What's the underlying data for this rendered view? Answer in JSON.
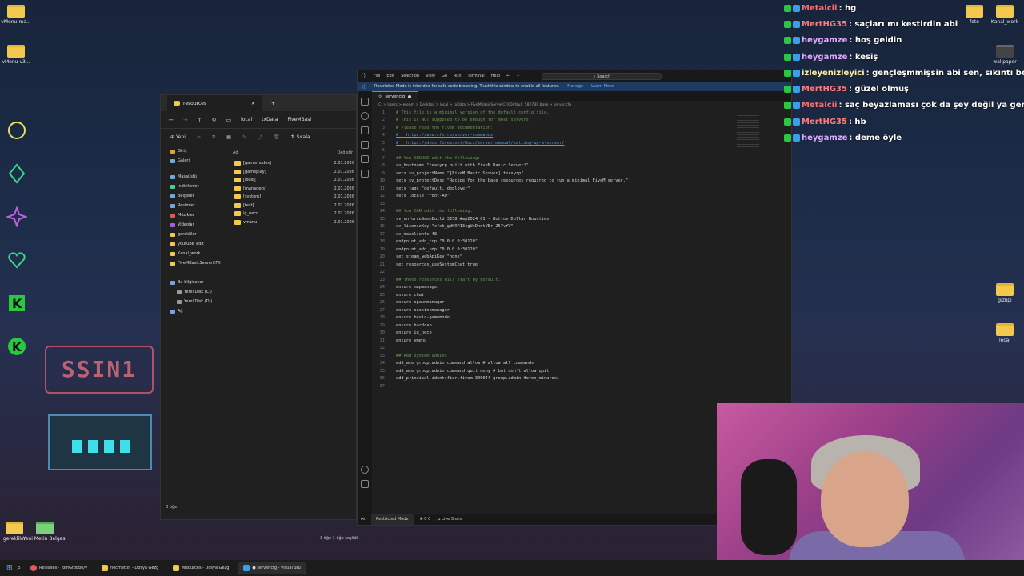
{
  "desktop": {
    "icons_left": [
      {
        "label": "vMenu-ma..."
      },
      {
        "label": "vMenu-v3..."
      }
    ],
    "icons_bottom": [
      {
        "label": "gerekliler"
      },
      {
        "label": "Yeni Metin Belgesi"
      }
    ],
    "icons_right": [
      {
        "label": "foto"
      },
      {
        "label": "Kanal_work"
      },
      {
        "label": "wallpaper"
      },
      {
        "label": "gizlipi"
      },
      {
        "label": "local"
      }
    ],
    "sign_text": "SSIN1"
  },
  "explorer": {
    "tab_title": "resources",
    "breadcrumbs": [
      "local",
      "txData",
      "FiveMBasi"
    ],
    "toolbar": {
      "new_label": "Yeni",
      "sort_label": "Sırala"
    },
    "sidebar": [
      "Giriş",
      "Galeri",
      "Masaüstü",
      "İndirilenler",
      "Belgeler",
      "Resimler",
      "Müzikler",
      "Videolar",
      "gerekliler",
      "youtube_edit",
      "Kanal_work",
      "FiveMBasicServerCFX",
      "Bu bilgisayar",
      "Yerel Disk (C:)",
      "Yerel Disk (D:)",
      "Ağ"
    ],
    "columns": {
      "name": "Ad",
      "date": "Değiştir"
    },
    "rows": [
      {
        "name": "[gamemodes]",
        "date": "2.01.2026"
      },
      {
        "name": "[gameplay]",
        "date": "2.01.2026"
      },
      {
        "name": "[local]",
        "date": "2.01.2026"
      },
      {
        "name": "[managers]",
        "date": "2.01.2026"
      },
      {
        "name": "[system]",
        "date": "2.01.2026"
      },
      {
        "name": "[test]",
        "date": "2.01.2026"
      },
      {
        "name": "ig_neco",
        "date": "2.01.2026"
      },
      {
        "name": "vmenu",
        "date": "2.01.2026"
      }
    ],
    "status": "8 öğe",
    "status2": "3 öğe   1 öğe seçildi"
  },
  "vscode": {
    "menu": [
      "File",
      "Edit",
      "Selection",
      "View",
      "Go",
      "Run",
      "Terminal",
      "Help"
    ],
    "search_placeholder": "Search",
    "banner": {
      "text": "Restricted Mode is intended for safe code browsing. Trust this window to enable all features.",
      "manage": "Manage",
      "learn": "Learn More"
    },
    "tab": "server.cfg",
    "breadcrumb": "C: > Users > erenm > Desktop > local > txData > FiveMBasicServerCFXDefault_5827B0.base > server.cfg",
    "status": {
      "restricted": "Restricted Mode",
      "problems": "0  0",
      "live_share": "Live Share"
    },
    "lines": [
      {
        "n": "1",
        "t": "# This file is a minimal version of the default config file.",
        "c": "cmt"
      },
      {
        "n": "2",
        "t": "# This is NOT supposed to be enough for most servers.",
        "c": "cmt"
      },
      {
        "n": "3",
        "t": "# Please read the fivem documentation:",
        "c": "cmt"
      },
      {
        "n": "4",
        "t": "#   https://aka.cfx.re/server-commands",
        "c": "link"
      },
      {
        "n": "5",
        "t": "#   https://docs.fivem.net/docs/server-manual/setting-up-a-server/",
        "c": "link"
      },
      {
        "n": "6",
        "t": "",
        "c": "kw"
      },
      {
        "n": "7",
        "t": "## You SHOULD edit the following:",
        "c": "cmt"
      },
      {
        "n": "8",
        "t": "sv_hostname \"teasyrp built with FiveM Basic Server!\"",
        "c": "mix"
      },
      {
        "n": "9",
        "t": "sets sv_projectName \"[FiveM Basic Server] teasyrp\"",
        "c": "mix"
      },
      {
        "n": "10",
        "t": "sets sv_projectDesc \"Recipe for the base resources required to run a minimal FiveM server.\"",
        "c": "mix"
      },
      {
        "n": "11",
        "t": "sets tags \"default, deployer\"",
        "c": "mix"
      },
      {
        "n": "12",
        "t": "sets locale \"root-AQ\"",
        "c": "mix"
      },
      {
        "n": "13",
        "t": "",
        "c": "kw"
      },
      {
        "n": "14",
        "t": "## You CAN edit the following:",
        "c": "cmt"
      },
      {
        "n": "15",
        "t": "sv_enforceGameBuild 3258 #mp2024_01 - Bottom Dollar Bounties",
        "c": "mix"
      },
      {
        "n": "16",
        "t": "sv_licenseKey \"cfxk_gdhRP13cgUsDnntVBr_257vYV\"",
        "c": "mix"
      },
      {
        "n": "17",
        "t": "sv_maxclients 48",
        "c": "kw"
      },
      {
        "n": "18",
        "t": "endpoint_add_tcp \"0.0.0.0:30120\"",
        "c": "mix"
      },
      {
        "n": "19",
        "t": "endpoint_add_udp \"0.0.0.0:30120\"",
        "c": "mix"
      },
      {
        "n": "20",
        "t": "set steam_webApiKey \"none\"",
        "c": "mix"
      },
      {
        "n": "21",
        "t": "set resources_useSystemChat true",
        "c": "kw"
      },
      {
        "n": "22",
        "t": "",
        "c": "kw"
      },
      {
        "n": "23",
        "t": "## These resources will start by default.",
        "c": "cmt"
      },
      {
        "n": "24",
        "t": "ensure mapmanager",
        "c": "kw"
      },
      {
        "n": "25",
        "t": "ensure chat",
        "c": "kw"
      },
      {
        "n": "26",
        "t": "ensure spawnmanager",
        "c": "kw"
      },
      {
        "n": "27",
        "t": "ensure sessionmanager",
        "c": "kw"
      },
      {
        "n": "28",
        "t": "ensure basic-gamemode",
        "c": "kw"
      },
      {
        "n": "29",
        "t": "ensure hardcap",
        "c": "kw"
      },
      {
        "n": "30",
        "t": "ensure ig_neco",
        "c": "kw"
      },
      {
        "n": "31",
        "t": "ensure vmenu",
        "c": "kw"
      },
      {
        "n": "32",
        "t": "",
        "c": "kw"
      },
      {
        "n": "33",
        "t": "## Add system admins",
        "c": "cmt"
      },
      {
        "n": "34",
        "t": "add_ace group.admin command allow # allow all commands",
        "c": "mix"
      },
      {
        "n": "35",
        "t": "add_ace group.admin command.quit deny # but don't allow quit",
        "c": "mix"
      },
      {
        "n": "36",
        "t": "add_principal identifier.fivem:300044 group.admin #eren_minareci",
        "c": "mix"
      },
      {
        "n": "37",
        "t": "",
        "c": "kw"
      }
    ]
  },
  "chat": [
    {
      "user": "Metalcii",
      "msg": ": hg",
      "color": "#ff6b6b"
    },
    {
      "user": "MertHG35",
      "msg": ": saçları mı kestirdin abi",
      "color": "#ff7a7a"
    },
    {
      "user": "heygamze",
      "msg": ": hoş geldin",
      "color": "#e3a7ff"
    },
    {
      "user": "heygamze",
      "msg": ": kesiş",
      "color": "#e3a7ff"
    },
    {
      "user": "izleyenizleyici",
      "msg": ": gençleşmmişsin abi sen, sıkıntı bende.",
      "color": "#fff0a0"
    },
    {
      "user": "MertHG35",
      "msg": ": güzel olmuş",
      "color": "#ff7a7a"
    },
    {
      "user": "Metalcii",
      "msg": ": saç beyazlaması çok da şey değil ya genetik",
      "color": "#ff6b6b"
    },
    {
      "user": "MertHG35",
      "msg": ": hb",
      "color": "#ff7a7a"
    },
    {
      "user": "heygamze",
      "msg": ": deme öyle",
      "color": "#e3a7ff"
    }
  ],
  "taskbar": [
    {
      "label": "Releases · TomGrobbe/v"
    },
    {
      "label": "necmettin - Dosya Gezg"
    },
    {
      "label": "resources - Dosya Gezg"
    },
    {
      "label": "● server.cfg - Visual Stu"
    }
  ]
}
